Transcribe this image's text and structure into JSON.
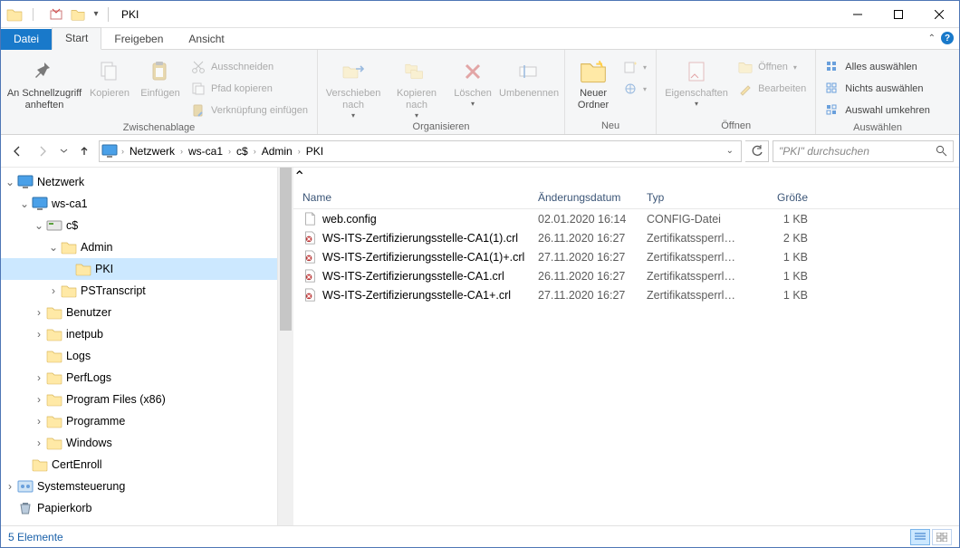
{
  "window": {
    "title": "PKI"
  },
  "tabs": {
    "file": "Datei",
    "start": "Start",
    "share": "Freigeben",
    "view": "Ansicht"
  },
  "ribbon": {
    "clipboard": {
      "label": "Zwischenablage",
      "pin": "An Schnellzugriff\nanheften",
      "copy": "Kopieren",
      "paste": "Einfügen",
      "cut": "Ausschneiden",
      "copypath": "Pfad kopieren",
      "pastelink": "Verknüpfung einfügen"
    },
    "organize": {
      "label": "Organisieren",
      "move": "Verschieben\nnach",
      "copyto": "Kopieren\nnach",
      "delete": "Löschen",
      "rename": "Umbenennen"
    },
    "new_": {
      "label": "Neu",
      "newfolder": "Neuer\nOrdner"
    },
    "open": {
      "label": "Öffnen",
      "properties": "Eigenschaften",
      "open": "Öffnen",
      "edit": "Bearbeiten"
    },
    "select": {
      "label": "Auswählen",
      "all": "Alles auswählen",
      "none": "Nichts auswählen",
      "invert": "Auswahl umkehren"
    }
  },
  "breadcrumb": [
    "Netzwerk",
    "ws-ca1",
    "c$",
    "Admin",
    "PKI"
  ],
  "search": {
    "placeholder": "\"PKI\" durchsuchen"
  },
  "tree": {
    "net": "Netzwerk",
    "host": "ws-ca1",
    "share": "c$",
    "admin": "Admin",
    "pki": "PKI",
    "pst": "PSTranscript",
    "benutzer": "Benutzer",
    "inetpub": "inetpub",
    "logs": "Logs",
    "perflogs": "PerfLogs",
    "progx86": "Program Files (x86)",
    "programme": "Programme",
    "windows": "Windows",
    "certenroll": "CertEnroll",
    "sys": "Systemsteuerung",
    "bin": "Papierkorb"
  },
  "columns": {
    "name": "Name",
    "date": "Änderungsdatum",
    "type": "Typ",
    "size": "Größe"
  },
  "files": [
    {
      "name": "web.config",
      "date": "02.01.2020 16:14",
      "type": "CONFIG-Datei",
      "size": "1 KB",
      "icon": "doc"
    },
    {
      "name": "WS-ITS-Zertifizierungsstelle-CA1(1).crl",
      "date": "26.11.2020 16:27",
      "type": "Zertifikatssperrliste",
      "size": "2 KB",
      "icon": "crl"
    },
    {
      "name": "WS-ITS-Zertifizierungsstelle-CA1(1)+.crl",
      "date": "27.11.2020 16:27",
      "type": "Zertifikatssperrliste",
      "size": "1 KB",
      "icon": "crl"
    },
    {
      "name": "WS-ITS-Zertifizierungsstelle-CA1.crl",
      "date": "26.11.2020 16:27",
      "type": "Zertifikatssperrliste",
      "size": "1 KB",
      "icon": "crl"
    },
    {
      "name": "WS-ITS-Zertifizierungsstelle-CA1+.crl",
      "date": "27.11.2020 16:27",
      "type": "Zertifikatssperrliste",
      "size": "1 KB",
      "icon": "crl"
    }
  ],
  "status": {
    "count": "5 Elemente"
  }
}
